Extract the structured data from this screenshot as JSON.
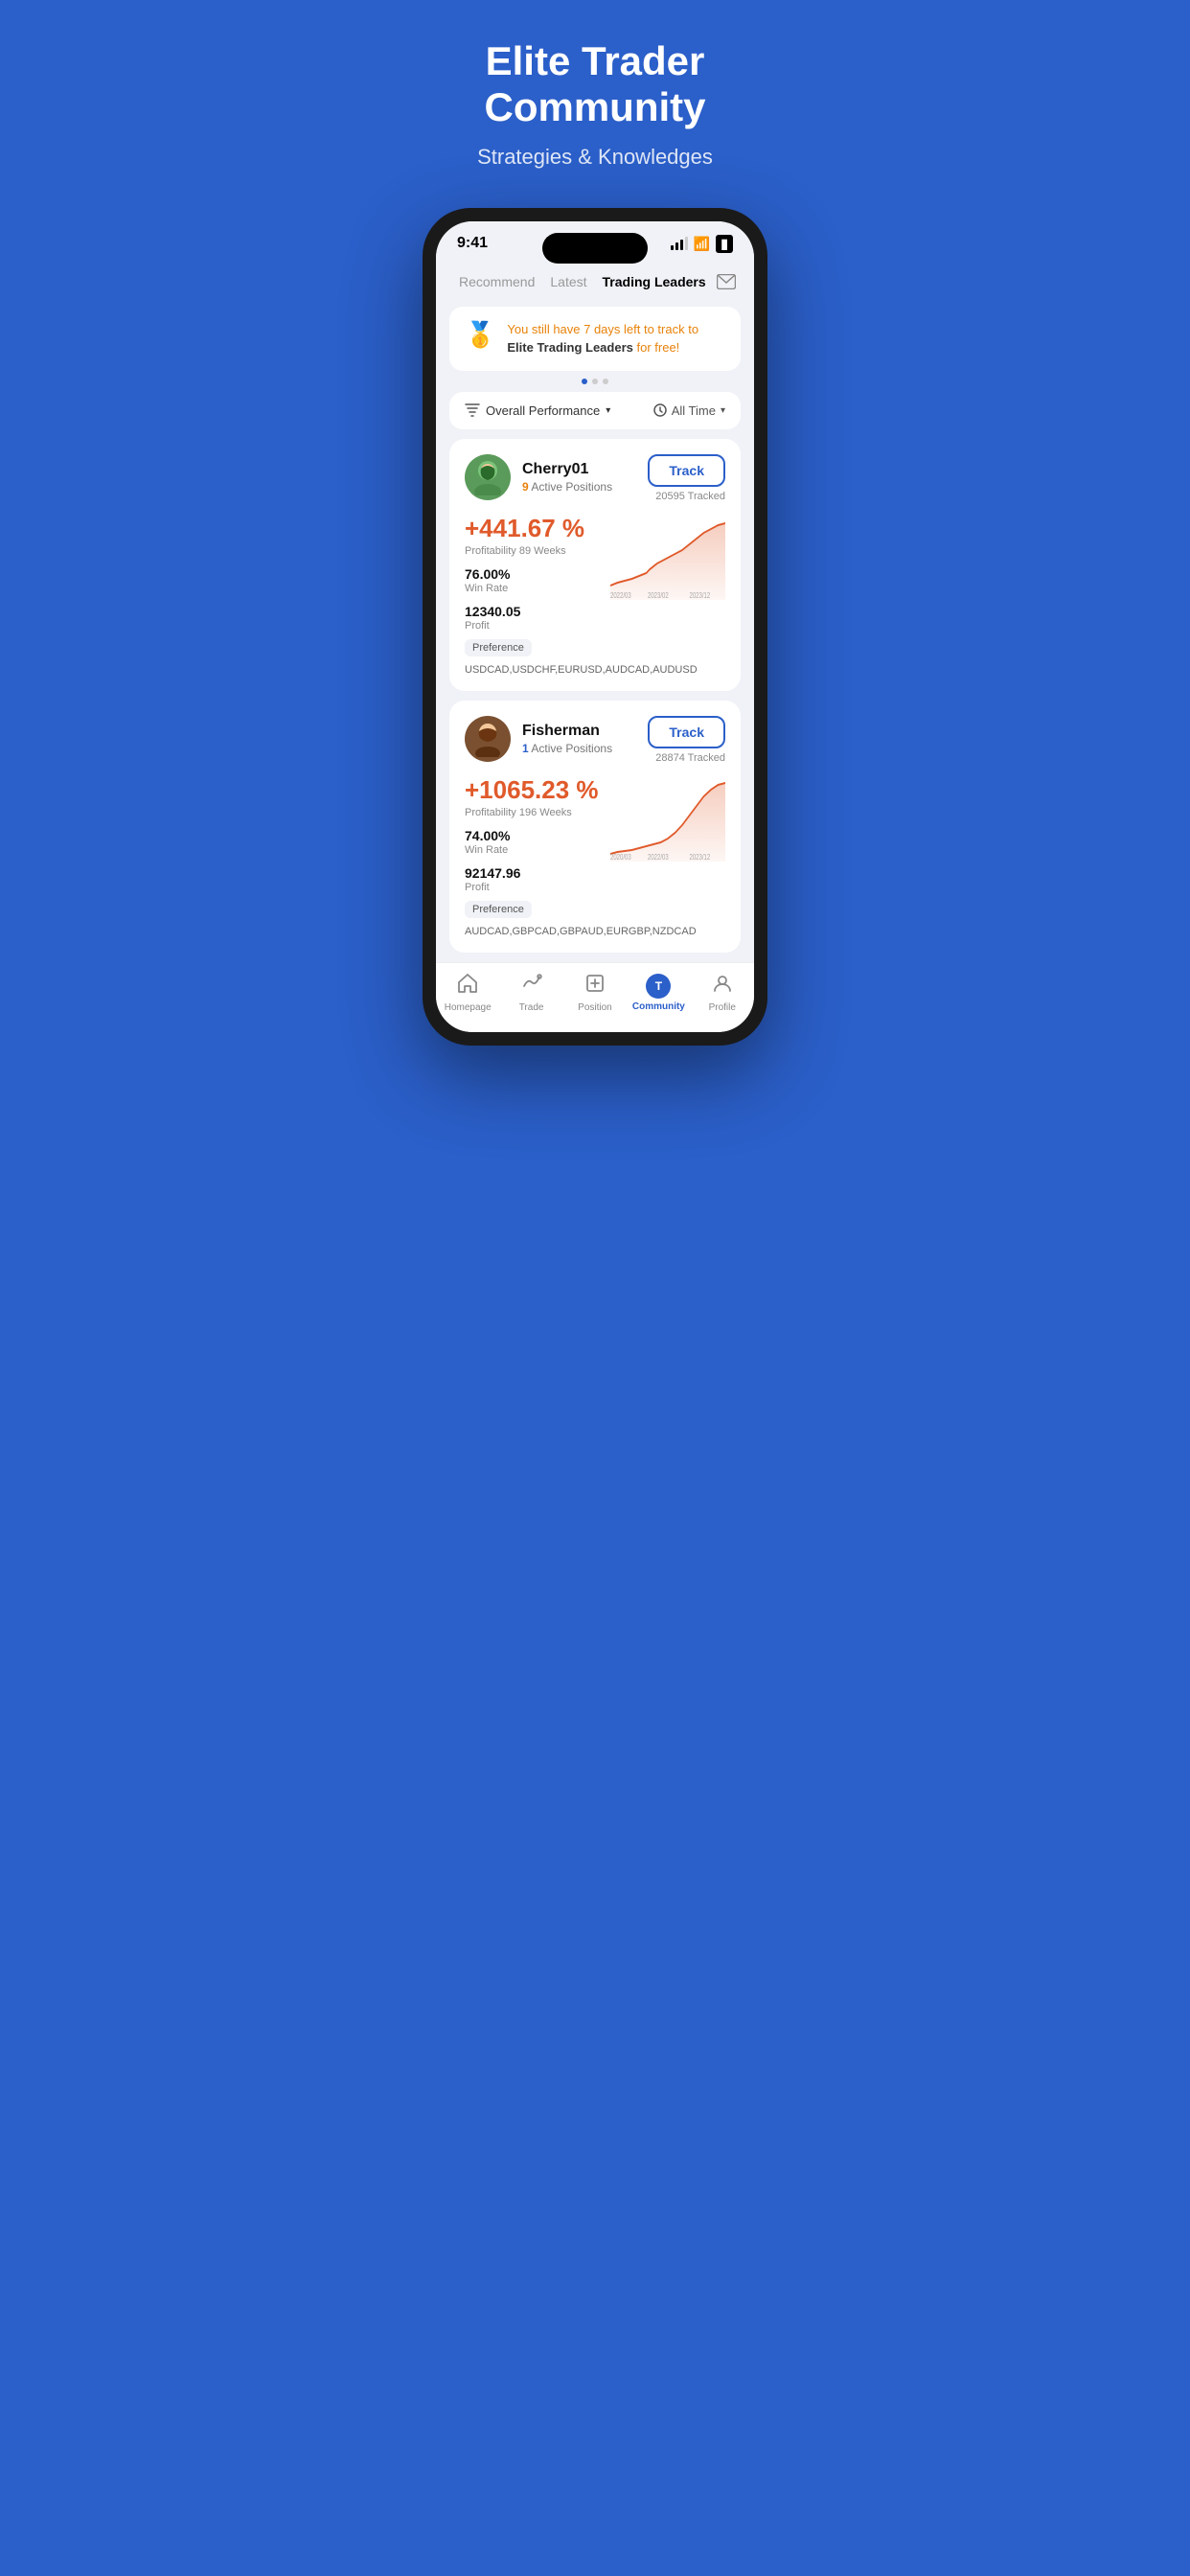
{
  "hero": {
    "title": "Elite Trader\nCommunity",
    "subtitle": "Strategies & Knowledges"
  },
  "phone": {
    "statusBar": {
      "time": "9:41",
      "signal": "●●●",
      "wifi": "WiFi",
      "battery": "Battery"
    },
    "tabs": [
      {
        "label": "Recommend",
        "active": false
      },
      {
        "label": "Latest",
        "active": false
      },
      {
        "label": "Trading Leaders",
        "active": true
      }
    ],
    "mailIcon": "✉",
    "promoBanner": {
      "emoji": "🥇",
      "textPart1": "You still have 7 days left to track to ",
      "textBold": "Elite Trading Leaders",
      "textPart2": " for free!"
    },
    "filterBar": {
      "sortLabel": "Overall Performance",
      "timeLabel": "All Time"
    },
    "traders": [
      {
        "id": "cherry01",
        "name": "Cherry01",
        "activePositions": 9,
        "activePositionsColor": "orange",
        "trackLabel": "Track",
        "trackedCount": "20595 Tracked",
        "profitPct": "+441.67 %",
        "profitability": "Profitability",
        "weeks": "89 Weeks",
        "winRate": "76.00%",
        "winRateLabel": "Win Rate",
        "profit": "12340.05",
        "profitLabel": "Profit",
        "preferenceLabel": "Preference",
        "currencies": "USDCAD,USDCHF,EURUSD,AUDCAD,AUDUSD",
        "chartDates": [
          "2022/03",
          "2023/02",
          "2023/12"
        ],
        "avatarEmoji": "🧑",
        "avatarBg": "#5a9a5a"
      },
      {
        "id": "fisherman",
        "name": "Fisherman",
        "activePositions": 1,
        "activePositionsColor": "blue",
        "trackLabel": "Track",
        "trackedCount": "28874 Tracked",
        "profitPct": "+1065.23 %",
        "profitability": "Profitability",
        "weeks": "196 Weeks",
        "winRate": "74.00%",
        "winRateLabel": "Win Rate",
        "profit": "92147.96",
        "profitLabel": "Profit",
        "preferenceLabel": "Preference",
        "currencies": "AUDCAD,GBPCAD,GBPAUD,EURGBP,NZDCAD",
        "chartDates": [
          "2020/03",
          "2022/03",
          "2023/12"
        ],
        "avatarEmoji": "👨",
        "avatarBg": "#7a5030"
      }
    ],
    "bottomNav": [
      {
        "label": "Homepage",
        "icon": "home",
        "active": false
      },
      {
        "label": "Trade",
        "icon": "trade",
        "active": false
      },
      {
        "label": "Position",
        "icon": "position",
        "active": false
      },
      {
        "label": "Community",
        "icon": "community",
        "active": true
      },
      {
        "label": "Profile",
        "icon": "profile",
        "active": false
      }
    ]
  }
}
